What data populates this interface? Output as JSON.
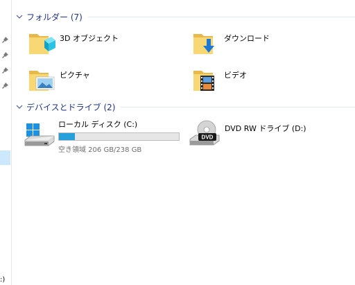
{
  "groups": {
    "folders": {
      "title": "フォルダー (7)",
      "items": [
        {
          "label": "3D オブジェクト",
          "icon": "3d-objects-folder-icon"
        },
        {
          "label": "ダウンロード",
          "icon": "downloads-folder-icon"
        },
        {
          "label": "ピクチャ",
          "icon": "pictures-folder-icon"
        },
        {
          "label": "ビデオ",
          "icon": "videos-folder-icon"
        }
      ]
    },
    "devices": {
      "title": "デバイスとドライブ (2)",
      "local_disk": {
        "label": "ローカル ディスク (C:)",
        "free_text": "空き領域 206 GB/238 GB",
        "used_fraction": 0.134,
        "icon": "windows-drive-icon"
      },
      "dvd": {
        "label": "DVD RW ドライブ (D:)",
        "icon_text": "DVD",
        "icon": "dvd-drive-icon"
      }
    }
  },
  "nav": {
    "fragment": ":)"
  },
  "colors": {
    "header_text": "#1e3287",
    "progress_fill": "#26a0da",
    "selection": "#cce8ff",
    "folder_yellow": "#f8d775"
  }
}
